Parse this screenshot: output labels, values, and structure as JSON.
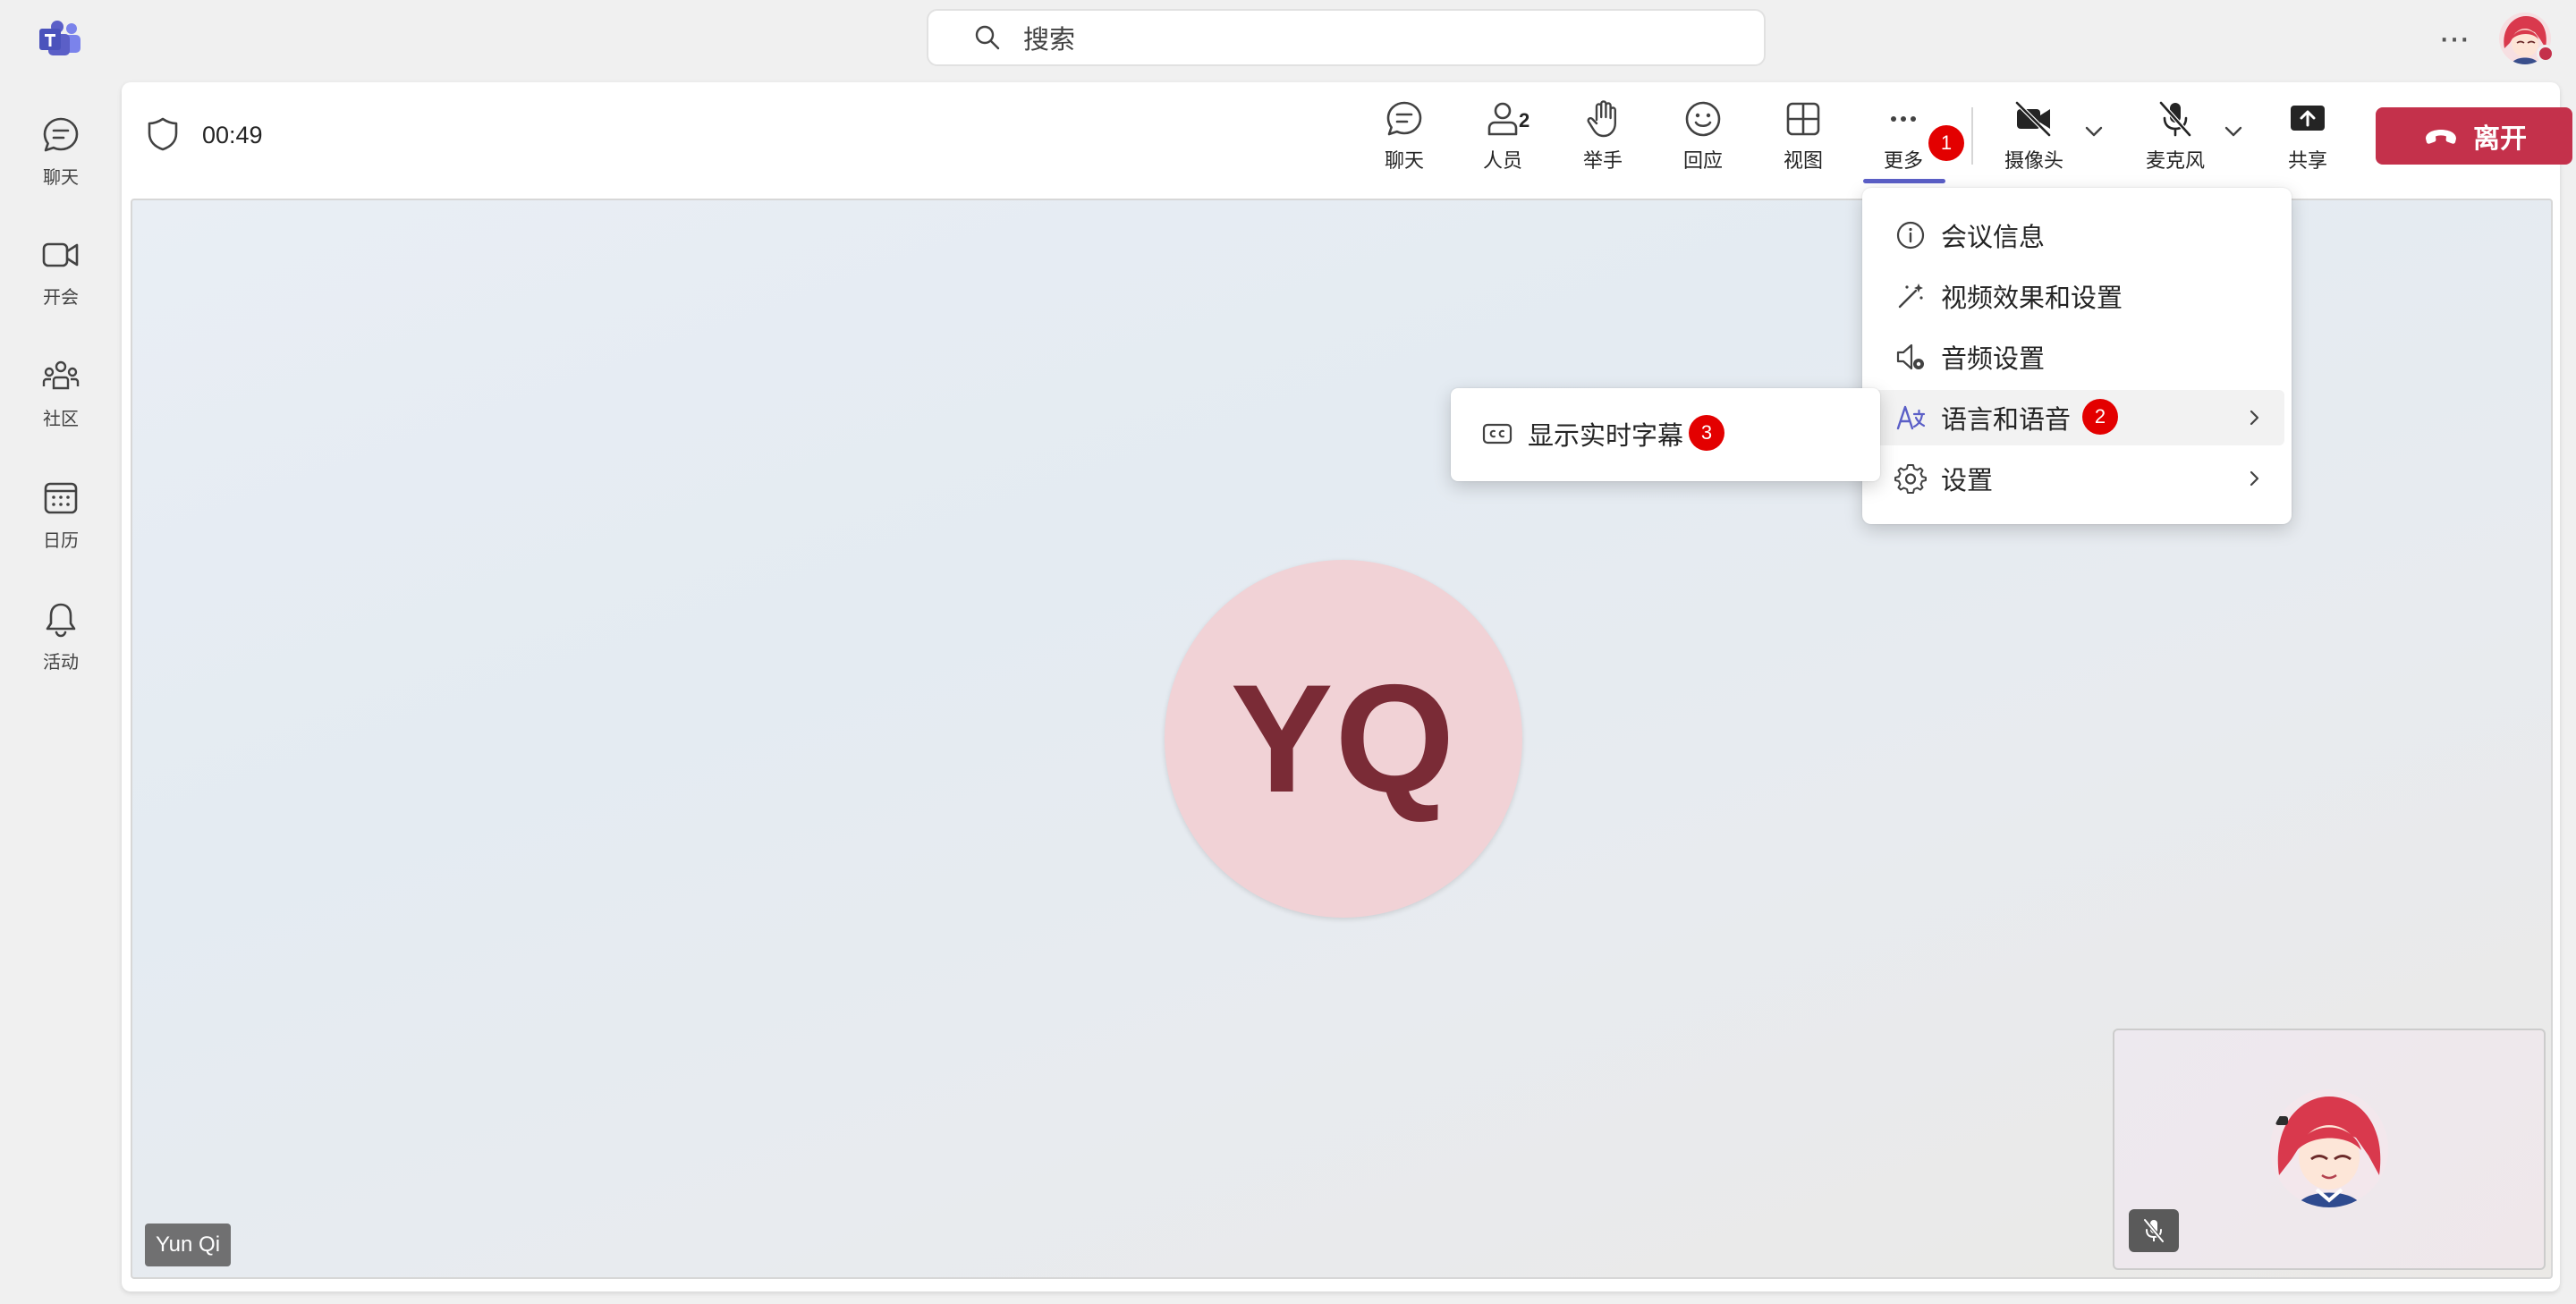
{
  "app": {
    "logo_icon": "teams-logo-icon"
  },
  "search": {
    "placeholder": "搜索"
  },
  "top_right": {
    "more_label": "···"
  },
  "rail": {
    "items": [
      {
        "label": "聊天",
        "icon": "chat-icon"
      },
      {
        "label": "开会",
        "icon": "video-camera-icon"
      },
      {
        "label": "社区",
        "icon": "community-icon"
      },
      {
        "label": "日历",
        "icon": "calendar-icon"
      },
      {
        "label": "活动",
        "icon": "bell-icon"
      }
    ]
  },
  "meeting": {
    "timer": "00:49",
    "toolbar": {
      "chat": "聊天",
      "people": "人员",
      "people_count": "2",
      "raise_hand": "举手",
      "react": "回应",
      "view": "视图",
      "more": "更多",
      "camera": "摄像头",
      "mic": "麦克风",
      "share": "共享",
      "leave": "离开"
    },
    "stage": {
      "avatar_initials": "YQ",
      "participant_name": "Yun Qi"
    }
  },
  "more_menu": {
    "items": [
      {
        "label": "会议信息",
        "icon": "info-icon"
      },
      {
        "label": "视频效果和设置",
        "icon": "magic-wand-icon"
      },
      {
        "label": "音频设置",
        "icon": "speaker-settings-icon"
      },
      {
        "label": "语言和语音",
        "icon": "language-icon"
      },
      {
        "label": "设置",
        "icon": "gear-icon"
      }
    ]
  },
  "submenu": {
    "items": [
      {
        "label": "显示实时字幕",
        "icon": "closed-captions-icon"
      }
    ]
  },
  "badges": {
    "b1": "1",
    "b2": "2",
    "b3": "3"
  },
  "colors": {
    "accent": "#5b5fc7",
    "leave": "#c4314b",
    "badge": "#e30000",
    "avatar_bg": "#f1d2d6",
    "avatar_text": "#7a2b36"
  }
}
